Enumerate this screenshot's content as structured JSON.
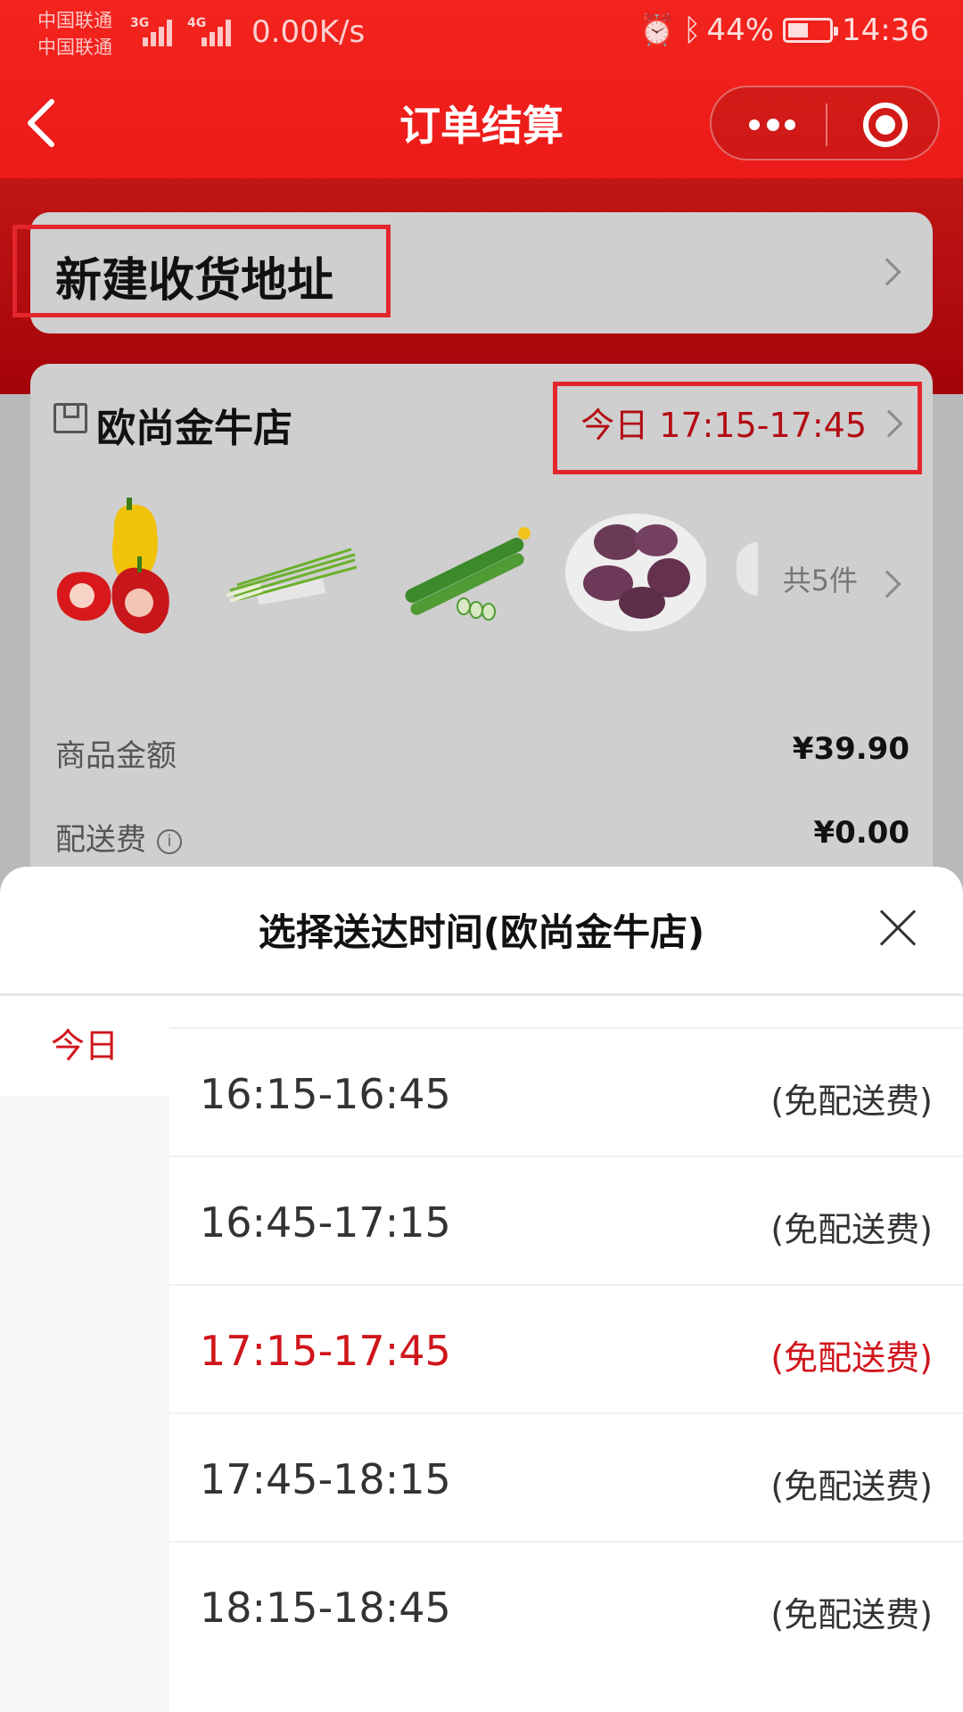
{
  "status_bar": {
    "carrier1": "中国联通",
    "carrier2": "中国联通",
    "net1": "3G",
    "net2": "4G",
    "speed": "0.00K/s",
    "battery": "44%",
    "time": "14:36"
  },
  "nav": {
    "title": "订单结算"
  },
  "address": {
    "label": "新建收货地址"
  },
  "store": {
    "name": "欧尚金牛店",
    "delivery_time": "今日 17:15-17:45",
    "items": [
      {
        "icon": "bell-pepper-image"
      },
      {
        "icon": "chives-image"
      },
      {
        "icon": "cucumber-image"
      },
      {
        "icon": "purple-sweet-potato-image"
      }
    ],
    "total_count": "共5件",
    "subtotal_label": "商品金额",
    "subtotal_value": "¥39.90",
    "delivery_fee_label": "配送费",
    "delivery_fee_value": "¥0.00"
  },
  "sheet": {
    "title": "选择送达时间(欧尚金牛店)",
    "days": [
      {
        "label": "今日",
        "selected": true
      }
    ],
    "slots": [
      {
        "time": "16:15-16:45",
        "fee": "(免配送费)",
        "selected": false
      },
      {
        "time": "16:45-17:15",
        "fee": "(免配送费)",
        "selected": false
      },
      {
        "time": "17:15-17:45",
        "fee": "(免配送费)",
        "selected": true
      },
      {
        "time": "17:45-18:15",
        "fee": "(免配送费)",
        "selected": false
      },
      {
        "time": "18:15-18:45",
        "fee": "(免配送费)",
        "selected": false
      }
    ]
  },
  "colors": {
    "brand_red": "#ec1b1a",
    "highlight_red": "#d0141b"
  }
}
